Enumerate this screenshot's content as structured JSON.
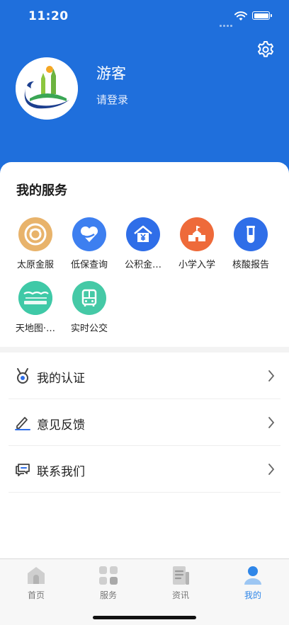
{
  "status_bar": {
    "time": "11:20"
  },
  "profile": {
    "name": "游客",
    "login_label": "请登录"
  },
  "services": {
    "title": "我的服务",
    "items": [
      {
        "label": "太原金服",
        "icon": "coin-icon",
        "color": "#e8b36b"
      },
      {
        "label": "低保查询",
        "icon": "heart-hands-icon",
        "color": "#3d7ff0"
      },
      {
        "label": "公积金…",
        "icon": "house-fund-icon",
        "color": "#2f6ee8"
      },
      {
        "label": "小学入学",
        "icon": "school-icon",
        "color": "#ee6a3a"
      },
      {
        "label": "核酸报告",
        "icon": "test-tube-icon",
        "color": "#2f6ee8"
      },
      {
        "label": "天地图·…",
        "icon": "map-world-icon",
        "color": "#3fc9a7"
      },
      {
        "label": "实时公交",
        "icon": "bus-icon",
        "color": "#45c9a6"
      }
    ]
  },
  "menu": [
    {
      "label": "我的认证",
      "icon": "medal-icon"
    },
    {
      "label": "意见反馈",
      "icon": "edit-icon"
    },
    {
      "label": "联系我们",
      "icon": "chat-icon"
    }
  ],
  "tabbar": [
    {
      "label": "首页",
      "icon": "home-icon",
      "active": false
    },
    {
      "label": "服务",
      "icon": "grid-icon",
      "active": false
    },
    {
      "label": "资讯",
      "icon": "news-icon",
      "active": false
    },
    {
      "label": "我的",
      "icon": "person-icon",
      "active": true
    }
  ],
  "colors": {
    "header": "#1f6fdc",
    "active_tab": "#2f86e8",
    "inactive_tab": "#777777"
  }
}
